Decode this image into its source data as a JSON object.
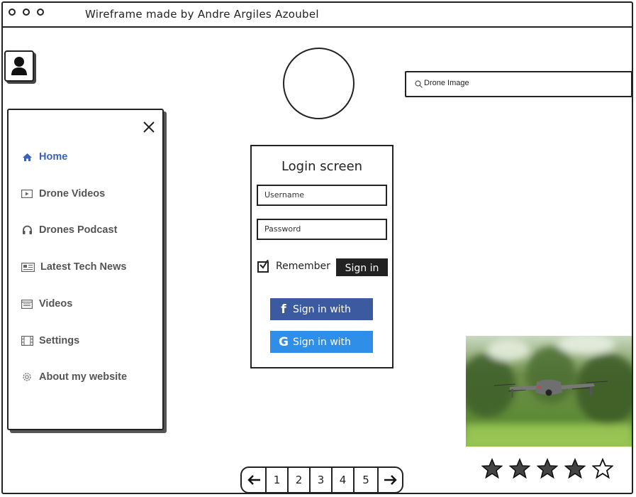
{
  "window": {
    "title": "Wireframe made by Andre Argiles Azoubel"
  },
  "search": {
    "value": "Drone Image",
    "icon": "search-icon"
  },
  "sidebar": {
    "items": [
      {
        "label": "Home",
        "icon": "home-icon",
        "active": true
      },
      {
        "label": "Drone Videos",
        "icon": "play-icon",
        "active": false
      },
      {
        "label": "Drones Podcast",
        "icon": "headphones-icon",
        "active": false
      },
      {
        "label": "Latest Tech News",
        "icon": "newspaper-icon",
        "active": false
      },
      {
        "label": "Videos",
        "icon": "list-icon",
        "active": false
      },
      {
        "label": "Settings",
        "icon": "film-icon",
        "active": false
      },
      {
        "label": "About my website",
        "icon": "gear-icon",
        "active": false
      }
    ]
  },
  "login": {
    "title": "Login screen",
    "username_placeholder": "Username",
    "password_placeholder": "Password",
    "remember_label": "Remember",
    "remember_checked": true,
    "sign_in_label": "Sign in",
    "facebook_label": "Sign in with",
    "google_label": "Sign in with"
  },
  "rating": {
    "value": 4,
    "max": 5
  },
  "pagination": {
    "pages": [
      "1",
      "2",
      "3",
      "4",
      "5"
    ]
  },
  "colors": {
    "active_nav": "#3a62b8",
    "facebook": "#3b5aa0",
    "google": "#2e8ee8"
  }
}
